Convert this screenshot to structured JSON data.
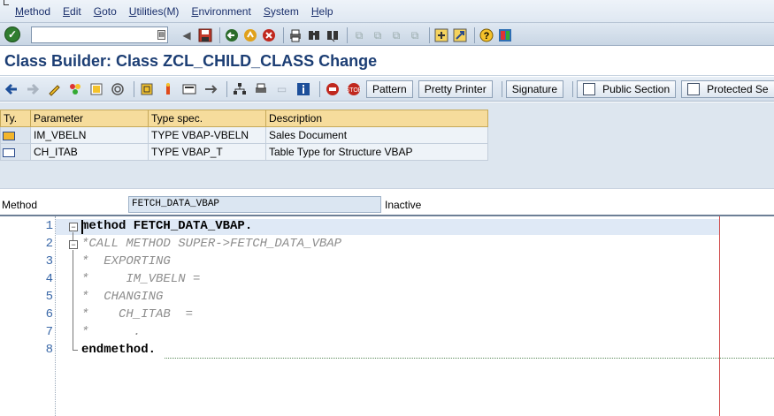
{
  "menu": [
    "Method",
    "Edit",
    "Goto",
    "Utilities(M)",
    "Environment",
    "System",
    "Help"
  ],
  "command_field": {
    "value": ""
  },
  "title": "Class Builder: Class ZCL_CHILD_CLASS Change",
  "app_buttons": {
    "pattern": "Pattern",
    "pretty_printer": "Pretty Printer",
    "signature": "Signature",
    "public_section": "Public Section",
    "protected_section": "Protected Se"
  },
  "params": {
    "headers": [
      "Ty.",
      "Parameter",
      "Type spec.",
      "Description"
    ],
    "rows": [
      {
        "name": "IM_VBELN",
        "type": "TYPE VBAP-VBELN",
        "desc": "Sales Document"
      },
      {
        "name": "CH_ITAB",
        "type": "TYPE VBAP_T",
        "desc": "Table Type for Structure VBAP"
      }
    ]
  },
  "method": {
    "label": "Method",
    "name": "FETCH_DATA_VBAP",
    "status": "Inactive"
  },
  "editor": {
    "line_numbers": [
      "1",
      "2",
      "3",
      "4",
      "5",
      "6",
      "7",
      "8"
    ],
    "lines": [
      "method FETCH_DATA_VBAP.",
      "*CALL METHOD SUPER->FETCH_DATA_VBAP",
      "*  EXPORTING",
      "*     IM_VBELN =",
      "*  CHANGING",
      "*    CH_ITAB  =",
      "*      .",
      "endmethod."
    ]
  },
  "icons": {
    "ok": "check-icon",
    "save": "save-icon",
    "back": "back-icon",
    "exit": "exit-icon",
    "cancel": "cancel-icon",
    "print": "print-icon",
    "find": "find-icon",
    "help": "help-icon"
  }
}
